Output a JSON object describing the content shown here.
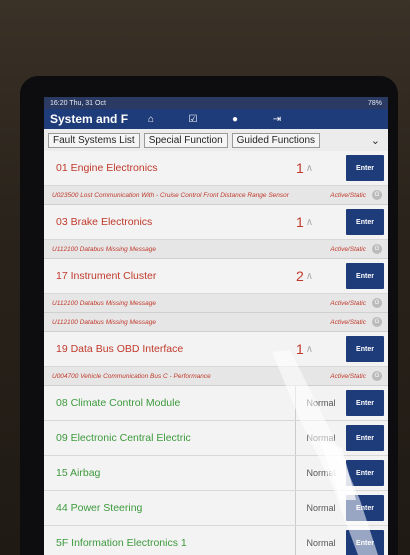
{
  "status_bar": {
    "time": "16:20  Thu, 31 Oct",
    "battery": "78%"
  },
  "app": {
    "title": "System and F"
  },
  "tabs": [
    "Fault Systems List",
    "Special Function",
    "Guided Functions"
  ],
  "rows": [
    {
      "name": "01 Engine Electronics",
      "count": "1",
      "enter": "Enter",
      "type": "fault",
      "dtcs": [
        {
          "text": "U023500 Lost Communication With - Cruise Control Front Distance Range Sensor",
          "status": "Active/Static"
        }
      ]
    },
    {
      "name": "03 Brake Electronics",
      "count": "1",
      "enter": "Enter",
      "type": "fault",
      "dtcs": [
        {
          "text": "U112100 Databus Missing Message",
          "status": "Active/Static"
        }
      ]
    },
    {
      "name": "17 Instrument Cluster",
      "count": "2",
      "enter": "Enter",
      "type": "fault",
      "dtcs": [
        {
          "text": "U112100 Databus Missing Message",
          "status": "Active/Static"
        },
        {
          "text": "U112100 Databus Missing Message",
          "status": "Active/Static"
        }
      ]
    },
    {
      "name": "19 Data Bus OBD Interface",
      "count": "1",
      "enter": "Enter",
      "type": "fault",
      "dtcs": [
        {
          "text": "U004700 Vehicle Communication Bus C - Performance",
          "status": "Active/Static"
        }
      ]
    },
    {
      "name": "08 Climate Control Module",
      "status": "Normal",
      "enter": "Enter",
      "type": "normal"
    },
    {
      "name": "09 Electronic Central Electric",
      "status": "Normal",
      "enter": "Enter",
      "type": "normal"
    },
    {
      "name": "15 Airbag",
      "status": "Normal",
      "enter": "Enter",
      "type": "normal"
    },
    {
      "name": "44 Power Steering",
      "status": "Normal",
      "enter": "Enter",
      "type": "normal"
    },
    {
      "name": "5F Information Electronics 1",
      "status": "Normal",
      "enter": "Enter",
      "type": "normal"
    }
  ]
}
